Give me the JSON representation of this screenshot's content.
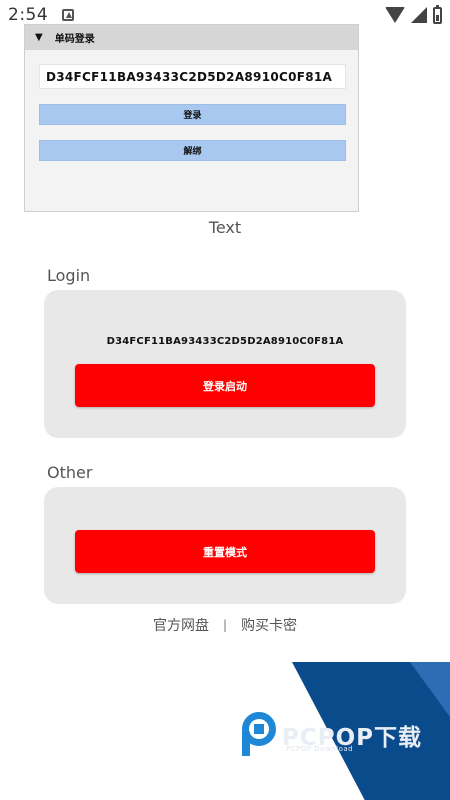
{
  "status_bar": {
    "time": "2:54",
    "icons": [
      "notification-icon",
      "wifi-icon",
      "signal-icon",
      "battery-icon"
    ]
  },
  "dialog": {
    "title": "单码登录",
    "code_value": "D34FCF11BA93433C2D5D2A8910C0F81A",
    "login_button": "登录",
    "unbind_button": "解绑"
  },
  "text_label": "Text",
  "login_section": {
    "title": "Login",
    "device_code": "D34FCF11BA93433C2D5D2A8910C0F81A",
    "start_button": "登录启动"
  },
  "other_section": {
    "title": "Other",
    "reset_button": "重置模式"
  },
  "links": {
    "official_drive": "官方网盘",
    "separator": "|",
    "buy_key": "购买卡密"
  },
  "watermark": {
    "brand": "PCPOP下载",
    "sub": "PCPOP Download"
  },
  "colors": {
    "accent_red": "#ff0000",
    "button_blue": "#a8c8ef",
    "watermark_blue": "#0a4b8c"
  }
}
